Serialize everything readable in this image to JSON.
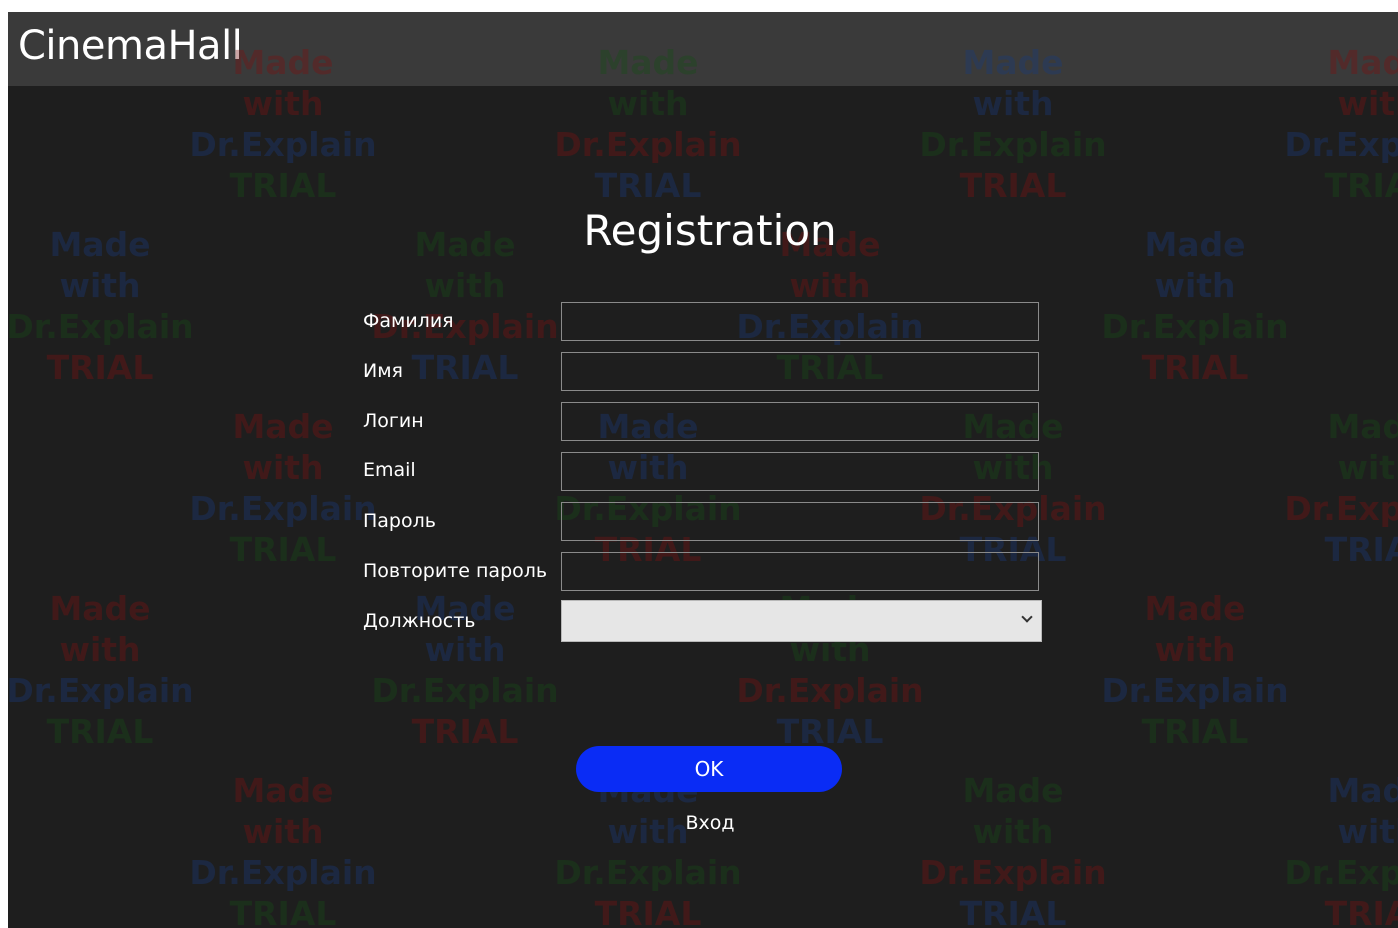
{
  "app": {
    "title": "CinemaHall"
  },
  "form": {
    "title": "Registration",
    "fields": [
      {
        "label": "Фамилия",
        "value": ""
      },
      {
        "label": "Имя",
        "value": ""
      },
      {
        "label": "Логин",
        "value": ""
      },
      {
        "label": "Email",
        "value": ""
      },
      {
        "label": "Пароль",
        "value": ""
      },
      {
        "label": "Повторите пароль",
        "value": ""
      }
    ],
    "position": {
      "label": "Должность",
      "selected": ""
    },
    "ok_label": "OK",
    "login_link": "Вход"
  },
  "watermark": {
    "line1": "Made with",
    "line2": "Dr.Explain",
    "line3": "TRIAL"
  },
  "colors": {
    "background": "#1e1e1e",
    "titlebar": "#3a3a3a",
    "accent_button": "#0a2cf5",
    "text": "#ffffff"
  }
}
